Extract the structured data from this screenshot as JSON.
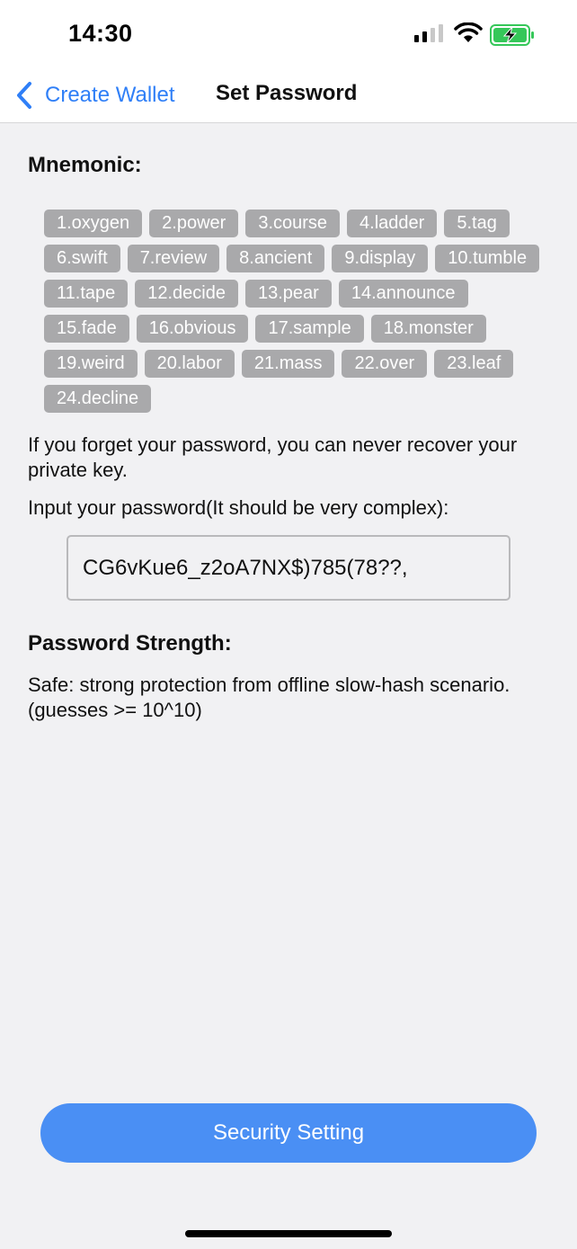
{
  "status_bar": {
    "time": "14:30",
    "signal_icon": "cellular-signal-icon",
    "wifi_icon": "wifi-icon",
    "battery_icon": "battery-charging-icon",
    "battery_color": "#35c759"
  },
  "nav": {
    "back_label": "Create Wallet",
    "title": "Set Password",
    "accent_color": "#2f7ff7"
  },
  "mnemonic": {
    "heading": "Mnemonic:",
    "words": [
      "1.oxygen",
      "2.power",
      "3.course",
      "4.ladder",
      "5.tag",
      "6.swift",
      "7.review",
      "8.ancient",
      "9.display",
      "10.tumble",
      "11.tape",
      "12.decide",
      "13.pear",
      "14.announce",
      "15.fade",
      "16.obvious",
      "17.sample",
      "18.monster",
      "19.weird",
      "20.labor",
      "21.mass",
      "22.over",
      "23.leaf",
      "24.decline"
    ]
  },
  "warning": "If you forget your password, you can never recover your private key.",
  "password": {
    "prompt": "Input your password(It should be very complex):",
    "value": "CG6vKue6_z2oA7NX$)785(78??,"
  },
  "strength": {
    "heading": "Password Strength:",
    "text": "Safe: strong protection from offline slow-hash scenario. (guesses >= 10^10)"
  },
  "action_button": {
    "label": "Security Setting",
    "color": "#4a8ff4"
  }
}
